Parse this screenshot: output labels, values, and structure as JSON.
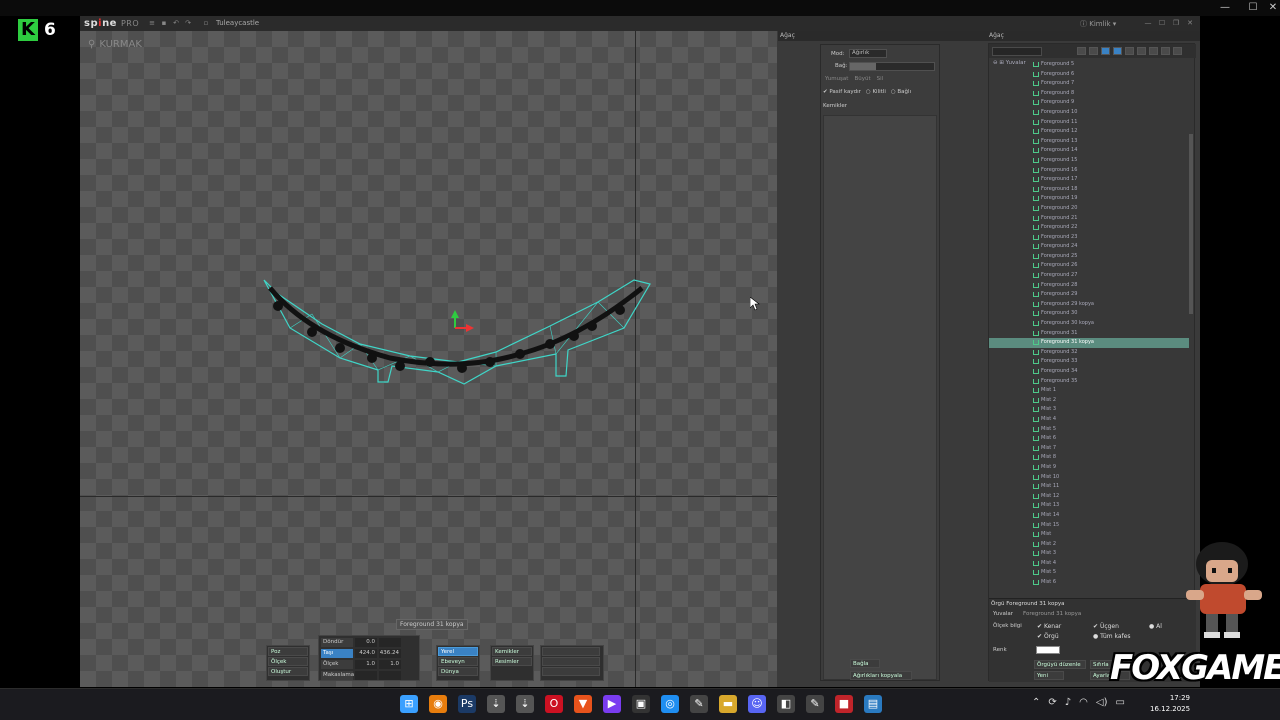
{
  "channel": {
    "logo_letter": "K",
    "logo_number": "6"
  },
  "app": {
    "logo": "sp",
    "logo_mid": "ne",
    "logo_pro": "PRO",
    "file_name": "Tuleaycastle",
    "account": "ⓘ Kimlik ▾"
  },
  "viewport": {
    "mode_label": "KURMAK",
    "hover_label": "Foreground 31 kopya",
    "mesh_color": "#3fd6c8"
  },
  "tools": {
    "pose": "Poz",
    "weights": "Ölçek",
    "create": "Oluştur",
    "transform_rows": [
      {
        "label": "Döndür",
        "v1": "0.0",
        "v2": ""
      },
      {
        "label": "Taşı",
        "v1": "424.0",
        "v2": "436.24"
      },
      {
        "label": "Ölçek",
        "v1": "1.0",
        "v2": "1.0"
      },
      {
        "label": "Makaslama",
        "v1": "",
        "v2": ""
      }
    ],
    "axes": [
      "Yerel",
      "Ebeveyn",
      "Dünya"
    ],
    "compensate": [
      "Kemikler",
      "Resimler"
    ]
  },
  "tree": {
    "tab": "Ağaç",
    "mode_label": "Mod:",
    "mode_value": "Ağırlık",
    "bind_label": "Bağ:",
    "buttons": [
      "Yumuşat",
      "Büyüt",
      "Sil"
    ],
    "options": [
      "Pasif kaydır",
      "Kilitli",
      "Bağlı"
    ],
    "bones_header": "Kemikler",
    "bottom_button": "Bağla",
    "bottom_button2": "Ağırlıkları kopyala"
  },
  "hierarchy": {
    "tab": "Ağaç",
    "root": "Yuvalar",
    "items": [
      "Foreground 5",
      "Foreground 6",
      "Foreground 7",
      "Foreground 8",
      "Foreground 9",
      "Foreground 10",
      "Foreground 11",
      "Foreground 12",
      "Foreground 13",
      "Foreground 14",
      "Foreground 15",
      "Foreground 16",
      "Foreground 17",
      "Foreground 18",
      "Foreground 19",
      "Foreground 20",
      "Foreground 21",
      "Foreground 22",
      "Foreground 23",
      "Foreground 24",
      "Foreground 25",
      "Foreground 26",
      "Foreground 27",
      "Foreground 28",
      "Foreground 29",
      "Foreground 29 kopya",
      "Foreground 30",
      "Foreground 30 kopya",
      "Foreground 31",
      "Foreground 31 kopya",
      "Foreground 32",
      "Foreground 33",
      "Foreground 34",
      "Foreground 35",
      "Mist 1",
      "Mist 2",
      "Mist 3",
      "Mist 4",
      "Mist 5",
      "Mist 6",
      "Mist 7",
      "Mist 8",
      "Mist 9",
      "Mist 10",
      "Mist 11",
      "Mist 12",
      "Mist 13",
      "Mist 14",
      "Mist 15",
      "Mist",
      "Mist 2",
      "Mist 3",
      "Mist 4",
      "Mist 5",
      "Mist 6"
    ],
    "selected_index": 29,
    "props_title": "Örgü Foreground 31 kopya",
    "props": {
      "mesh_label": "Yuvalar",
      "mesh_value": "Foreground 31 kopya",
      "weights_label": "Ölçek bilgi",
      "chk_edges": "Kenar",
      "chk_mesh": "Örgü",
      "chk_triangles": "Üçgen",
      "chk_hull": "Tüm kafes",
      "chk_all": "Al",
      "color_label": "Renk",
      "btn_edit": "Örgüyü düzenle",
      "btn_reset": "Sıfırla",
      "btn_new": "Yeni",
      "btn_set": "Ayarla"
    }
  },
  "overlay": {
    "brand": "FOXGAME"
  },
  "taskbar": {
    "apps": [
      {
        "name": "start",
        "glyph": "⊞",
        "color": "#3aa0ff"
      },
      {
        "name": "blender",
        "glyph": "◉",
        "color": "#e87d0d"
      },
      {
        "name": "photoshop",
        "glyph": "Ps",
        "color": "#1b3a66"
      },
      {
        "name": "spine",
        "glyph": "⇣",
        "color": "#555"
      },
      {
        "name": "spine2",
        "glyph": "⇣",
        "color": "#555"
      },
      {
        "name": "opera",
        "glyph": "O",
        "color": "#cc1122"
      },
      {
        "name": "brave",
        "glyph": "▼",
        "color": "#e8531c"
      },
      {
        "name": "clipchamp",
        "glyph": "▶",
        "color": "#7a3cf0"
      },
      {
        "name": "photos",
        "glyph": "▣",
        "color": "#333"
      },
      {
        "name": "chrome",
        "glyph": "◎",
        "color": "#1f8ef1"
      },
      {
        "name": "tool1",
        "glyph": "✎",
        "color": "#444"
      },
      {
        "name": "explorer",
        "glyph": "▬",
        "color": "#d8a82c"
      },
      {
        "name": "discord",
        "glyph": "☺",
        "color": "#5865f2"
      },
      {
        "name": "notepad",
        "glyph": "◧",
        "color": "#444"
      },
      {
        "name": "tool2",
        "glyph": "✎",
        "color": "#444"
      },
      {
        "name": "app-red",
        "glyph": "■",
        "color": "#c0242a"
      },
      {
        "name": "app-blue",
        "glyph": "▤",
        "color": "#2a7ac0"
      }
    ],
    "time": "17:29",
    "date": "16.12.2025"
  }
}
